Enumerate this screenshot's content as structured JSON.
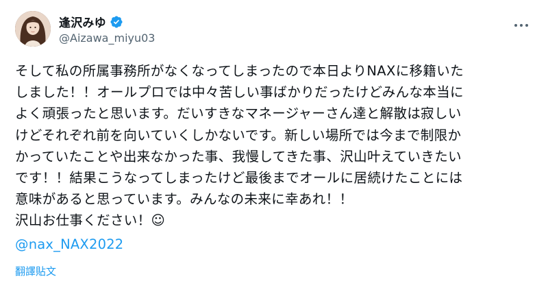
{
  "tweet": {
    "author": {
      "display_name": "逢沢みゆ",
      "handle": "@Aizawa_miyu03",
      "verified": true,
      "avatar_icon": "avatar-photo"
    },
    "more_icon": "more-horizontal-icon",
    "lines": [
      "そして私の所属事務所がなくなってしまったので本日よりNAXに移籍いた",
      "しました！！オールプロでは中々苦しい事ばかりだったけどみんな本当に",
      "よく頑張ったと思います。だいすきなマネージャーさん達と解散は寂しい",
      "けどそれぞれ前を向いていくしかないです。新しい場所では今まで制限か",
      "かっていたことや出来なかった事、我慢してきた事、沢山叶えていきたい",
      "です！！結果こうなってしまったけど最後までオールに居続けたことには",
      "意味があると思っています。みんなの未来に幸あれ！！",
      "沢山お仕事ください！☺"
    ],
    "mention": "@nax_NAX2022",
    "translate_label": "翻譯貼文",
    "colors": {
      "link": "#1d9bf0",
      "text": "#0f1419",
      "secondary": "#536471"
    }
  }
}
